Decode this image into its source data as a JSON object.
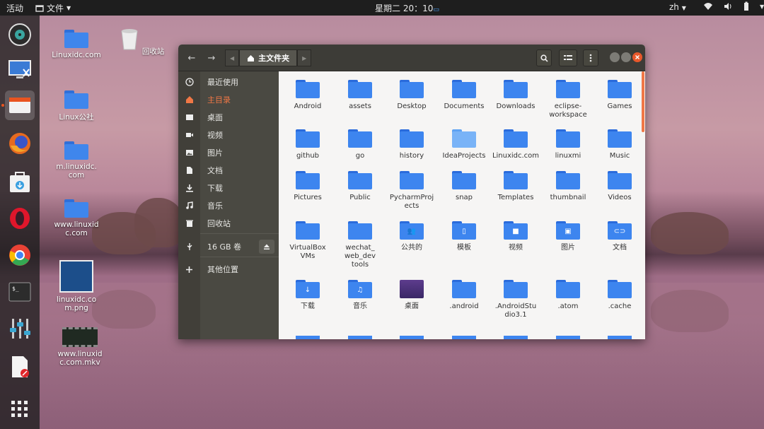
{
  "topbar": {
    "activities": "活动",
    "app_menu": "文件",
    "clock": "星期二 20：10",
    "lang": "zh"
  },
  "dock": {
    "items": [
      {
        "name": "rhythmbox-icon"
      },
      {
        "name": "remote-desktop-icon"
      },
      {
        "name": "files-icon"
      },
      {
        "name": "firefox-icon"
      },
      {
        "name": "software-store-icon"
      },
      {
        "name": "opera-icon"
      },
      {
        "name": "chrome-icon"
      },
      {
        "name": "terminal-icon"
      },
      {
        "name": "settings-tweaks-icon"
      },
      {
        "name": "document-editor-icon"
      },
      {
        "name": "show-apps-icon"
      }
    ]
  },
  "desktop": {
    "icons": [
      {
        "label": "Linuxidc.com"
      },
      {
        "label": "回收站"
      },
      {
        "label": "Linux公社"
      },
      {
        "label": "m.linuxidc.com"
      },
      {
        "label": "www.linuxidc.com"
      },
      {
        "label": "linuxidc.com.png"
      },
      {
        "label": "www.linuxidc.com.mkv"
      }
    ]
  },
  "window": {
    "path_current": "主文件夹",
    "sidebar": {
      "items": [
        {
          "label": "最近使用",
          "icon": "clock-icon"
        },
        {
          "label": "主目录",
          "icon": "home-icon"
        },
        {
          "label": "桌面",
          "icon": "desktop-icon"
        },
        {
          "label": "视频",
          "icon": "video-icon"
        },
        {
          "label": "图片",
          "icon": "picture-icon"
        },
        {
          "label": "文档",
          "icon": "document-icon"
        },
        {
          "label": "下载",
          "icon": "download-icon"
        },
        {
          "label": "音乐",
          "icon": "music-icon"
        },
        {
          "label": "回收站",
          "icon": "trash-icon"
        },
        {
          "label": "16 GB 卷",
          "icon": "usb-icon"
        },
        {
          "label": "其他位置",
          "icon": "plus-icon"
        }
      ]
    },
    "files": [
      {
        "label": "Android"
      },
      {
        "label": "assets"
      },
      {
        "label": "Desktop"
      },
      {
        "label": "Documents"
      },
      {
        "label": "Downloads"
      },
      {
        "label": "eclipse-workspace"
      },
      {
        "label": "Games"
      },
      {
        "label": "github"
      },
      {
        "label": "go"
      },
      {
        "label": "history"
      },
      {
        "label": "IdeaProjects"
      },
      {
        "label": "Linuxidc.com"
      },
      {
        "label": "linuxmi"
      },
      {
        "label": "Music"
      },
      {
        "label": "Pictures"
      },
      {
        "label": "Public"
      },
      {
        "label": "PycharmProjects"
      },
      {
        "label": "snap"
      },
      {
        "label": "Templates"
      },
      {
        "label": "thumbnail"
      },
      {
        "label": "Videos"
      },
      {
        "label": "VirtualBox VMs"
      },
      {
        "label": "wechat_web_devtools"
      },
      {
        "label": "公共的"
      },
      {
        "label": "模板"
      },
      {
        "label": "视频"
      },
      {
        "label": "图片"
      },
      {
        "label": "文档"
      },
      {
        "label": "下载"
      },
      {
        "label": "音乐"
      },
      {
        "label": "桌面"
      },
      {
        "label": ".android"
      },
      {
        "label": ".AndroidStudio3.1"
      },
      {
        "label": ".atom"
      },
      {
        "label": ".cache"
      }
    ]
  }
}
